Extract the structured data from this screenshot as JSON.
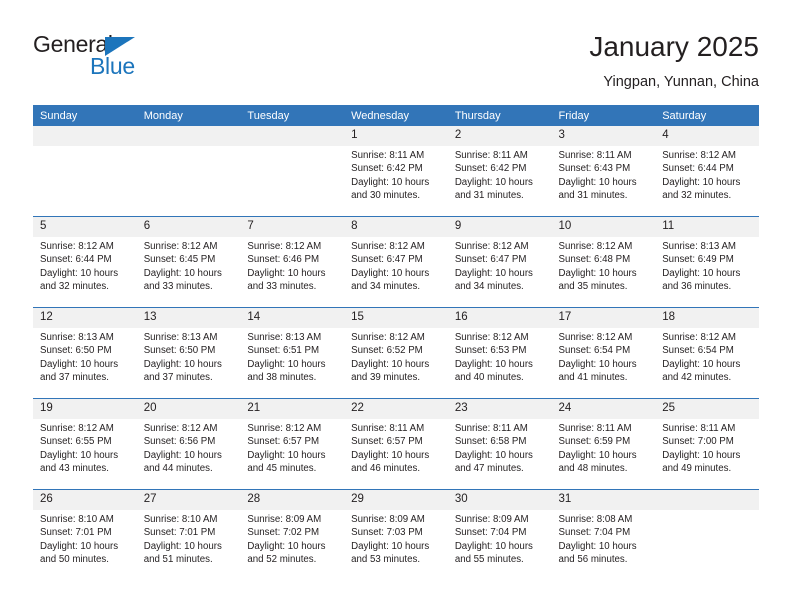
{
  "brand": {
    "name_top": "General",
    "name_bottom": "Blue",
    "accent_color": "#1c75bc"
  },
  "header": {
    "title": "January 2025",
    "subtitle": "Yingpan, Yunnan, China"
  },
  "theme": {
    "header_row_bg": "#3275b8",
    "daynum_bg": "#f1f1f1",
    "text_color": "#231f20"
  },
  "weekdays": [
    "Sunday",
    "Monday",
    "Tuesday",
    "Wednesday",
    "Thursday",
    "Friday",
    "Saturday"
  ],
  "weeks": [
    [
      {
        "day": "",
        "blank": true,
        "sunrise": "",
        "sunset": "",
        "daylight": ""
      },
      {
        "day": "",
        "blank": true,
        "sunrise": "",
        "sunset": "",
        "daylight": ""
      },
      {
        "day": "",
        "blank": true,
        "sunrise": "",
        "sunset": "",
        "daylight": ""
      },
      {
        "day": "1",
        "blank": false,
        "sunrise": "Sunrise: 8:11 AM",
        "sunset": "Sunset: 6:42 PM",
        "daylight": "Daylight: 10 hours and 30 minutes."
      },
      {
        "day": "2",
        "blank": false,
        "sunrise": "Sunrise: 8:11 AM",
        "sunset": "Sunset: 6:42 PM",
        "daylight": "Daylight: 10 hours and 31 minutes."
      },
      {
        "day": "3",
        "blank": false,
        "sunrise": "Sunrise: 8:11 AM",
        "sunset": "Sunset: 6:43 PM",
        "daylight": "Daylight: 10 hours and 31 minutes."
      },
      {
        "day": "4",
        "blank": false,
        "sunrise": "Sunrise: 8:12 AM",
        "sunset": "Sunset: 6:44 PM",
        "daylight": "Daylight: 10 hours and 32 minutes."
      }
    ],
    [
      {
        "day": "5",
        "blank": false,
        "sunrise": "Sunrise: 8:12 AM",
        "sunset": "Sunset: 6:44 PM",
        "daylight": "Daylight: 10 hours and 32 minutes."
      },
      {
        "day": "6",
        "blank": false,
        "sunrise": "Sunrise: 8:12 AM",
        "sunset": "Sunset: 6:45 PM",
        "daylight": "Daylight: 10 hours and 33 minutes."
      },
      {
        "day": "7",
        "blank": false,
        "sunrise": "Sunrise: 8:12 AM",
        "sunset": "Sunset: 6:46 PM",
        "daylight": "Daylight: 10 hours and 33 minutes."
      },
      {
        "day": "8",
        "blank": false,
        "sunrise": "Sunrise: 8:12 AM",
        "sunset": "Sunset: 6:47 PM",
        "daylight": "Daylight: 10 hours and 34 minutes."
      },
      {
        "day": "9",
        "blank": false,
        "sunrise": "Sunrise: 8:12 AM",
        "sunset": "Sunset: 6:47 PM",
        "daylight": "Daylight: 10 hours and 34 minutes."
      },
      {
        "day": "10",
        "blank": false,
        "sunrise": "Sunrise: 8:12 AM",
        "sunset": "Sunset: 6:48 PM",
        "daylight": "Daylight: 10 hours and 35 minutes."
      },
      {
        "day": "11",
        "blank": false,
        "sunrise": "Sunrise: 8:13 AM",
        "sunset": "Sunset: 6:49 PM",
        "daylight": "Daylight: 10 hours and 36 minutes."
      }
    ],
    [
      {
        "day": "12",
        "blank": false,
        "sunrise": "Sunrise: 8:13 AM",
        "sunset": "Sunset: 6:50 PM",
        "daylight": "Daylight: 10 hours and 37 minutes."
      },
      {
        "day": "13",
        "blank": false,
        "sunrise": "Sunrise: 8:13 AM",
        "sunset": "Sunset: 6:50 PM",
        "daylight": "Daylight: 10 hours and 37 minutes."
      },
      {
        "day": "14",
        "blank": false,
        "sunrise": "Sunrise: 8:13 AM",
        "sunset": "Sunset: 6:51 PM",
        "daylight": "Daylight: 10 hours and 38 minutes."
      },
      {
        "day": "15",
        "blank": false,
        "sunrise": "Sunrise: 8:12 AM",
        "sunset": "Sunset: 6:52 PM",
        "daylight": "Daylight: 10 hours and 39 minutes."
      },
      {
        "day": "16",
        "blank": false,
        "sunrise": "Sunrise: 8:12 AM",
        "sunset": "Sunset: 6:53 PM",
        "daylight": "Daylight: 10 hours and 40 minutes."
      },
      {
        "day": "17",
        "blank": false,
        "sunrise": "Sunrise: 8:12 AM",
        "sunset": "Sunset: 6:54 PM",
        "daylight": "Daylight: 10 hours and 41 minutes."
      },
      {
        "day": "18",
        "blank": false,
        "sunrise": "Sunrise: 8:12 AM",
        "sunset": "Sunset: 6:54 PM",
        "daylight": "Daylight: 10 hours and 42 minutes."
      }
    ],
    [
      {
        "day": "19",
        "blank": false,
        "sunrise": "Sunrise: 8:12 AM",
        "sunset": "Sunset: 6:55 PM",
        "daylight": "Daylight: 10 hours and 43 minutes."
      },
      {
        "day": "20",
        "blank": false,
        "sunrise": "Sunrise: 8:12 AM",
        "sunset": "Sunset: 6:56 PM",
        "daylight": "Daylight: 10 hours and 44 minutes."
      },
      {
        "day": "21",
        "blank": false,
        "sunrise": "Sunrise: 8:12 AM",
        "sunset": "Sunset: 6:57 PM",
        "daylight": "Daylight: 10 hours and 45 minutes."
      },
      {
        "day": "22",
        "blank": false,
        "sunrise": "Sunrise: 8:11 AM",
        "sunset": "Sunset: 6:57 PM",
        "daylight": "Daylight: 10 hours and 46 minutes."
      },
      {
        "day": "23",
        "blank": false,
        "sunrise": "Sunrise: 8:11 AM",
        "sunset": "Sunset: 6:58 PM",
        "daylight": "Daylight: 10 hours and 47 minutes."
      },
      {
        "day": "24",
        "blank": false,
        "sunrise": "Sunrise: 8:11 AM",
        "sunset": "Sunset: 6:59 PM",
        "daylight": "Daylight: 10 hours and 48 minutes."
      },
      {
        "day": "25",
        "blank": false,
        "sunrise": "Sunrise: 8:11 AM",
        "sunset": "Sunset: 7:00 PM",
        "daylight": "Daylight: 10 hours and 49 minutes."
      }
    ],
    [
      {
        "day": "26",
        "blank": false,
        "sunrise": "Sunrise: 8:10 AM",
        "sunset": "Sunset: 7:01 PM",
        "daylight": "Daylight: 10 hours and 50 minutes."
      },
      {
        "day": "27",
        "blank": false,
        "sunrise": "Sunrise: 8:10 AM",
        "sunset": "Sunset: 7:01 PM",
        "daylight": "Daylight: 10 hours and 51 minutes."
      },
      {
        "day": "28",
        "blank": false,
        "sunrise": "Sunrise: 8:09 AM",
        "sunset": "Sunset: 7:02 PM",
        "daylight": "Daylight: 10 hours and 52 minutes."
      },
      {
        "day": "29",
        "blank": false,
        "sunrise": "Sunrise: 8:09 AM",
        "sunset": "Sunset: 7:03 PM",
        "daylight": "Daylight: 10 hours and 53 minutes."
      },
      {
        "day": "30",
        "blank": false,
        "sunrise": "Sunrise: 8:09 AM",
        "sunset": "Sunset: 7:04 PM",
        "daylight": "Daylight: 10 hours and 55 minutes."
      },
      {
        "day": "31",
        "blank": false,
        "sunrise": "Sunrise: 8:08 AM",
        "sunset": "Sunset: 7:04 PM",
        "daylight": "Daylight: 10 hours and 56 minutes."
      },
      {
        "day": "",
        "blank": true,
        "sunrise": "",
        "sunset": "",
        "daylight": ""
      }
    ]
  ]
}
